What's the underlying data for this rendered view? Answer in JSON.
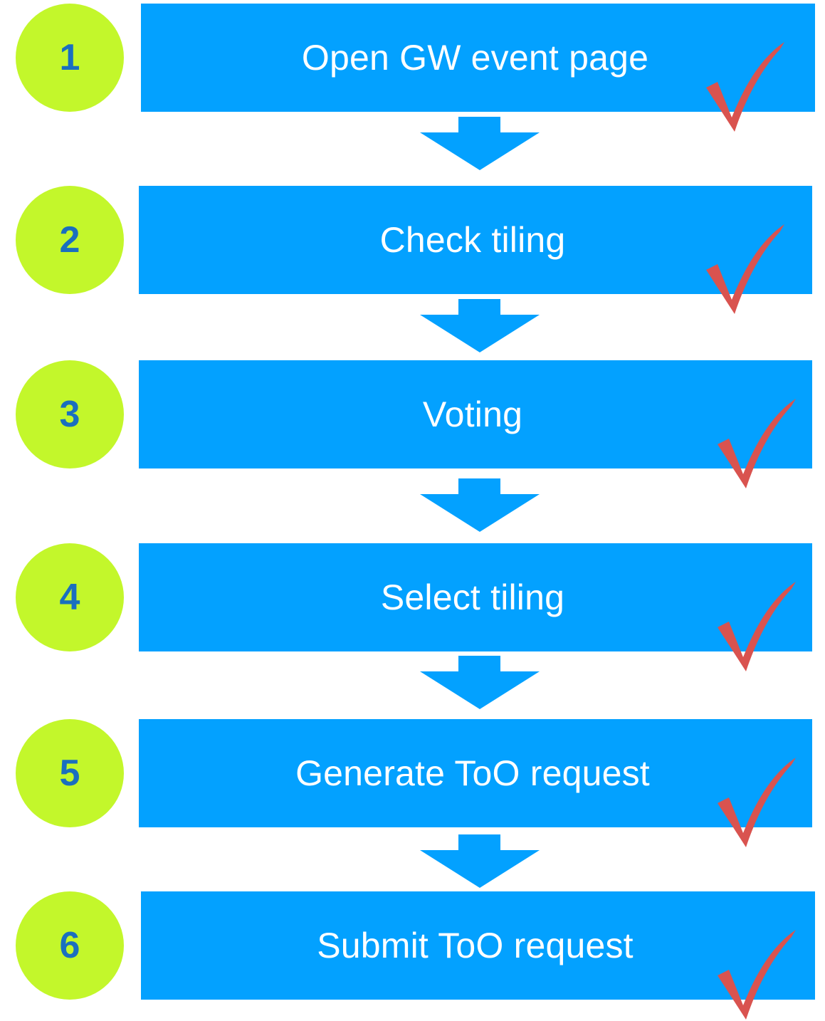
{
  "colors": {
    "step_circle": "#c3f72b",
    "step_number": "#1a6fbf",
    "box": "#03a1ff",
    "box_text": "#ffffff",
    "arrow": "#03a1ff",
    "check": "#d9534f"
  },
  "steps": [
    {
      "number": "1",
      "label": "Open GW event page",
      "status_icon": "checkmark-icon"
    },
    {
      "number": "2",
      "label": "Check tiling",
      "status_icon": "checkmark-icon"
    },
    {
      "number": "3",
      "label": "Voting",
      "status_icon": "checkmark-icon"
    },
    {
      "number": "4",
      "label": "Select tiling",
      "status_icon": "checkmark-icon"
    },
    {
      "number": "5",
      "label": "Generate ToO request",
      "status_icon": "checkmark-icon"
    },
    {
      "number": "6",
      "label": "Submit ToO request",
      "status_icon": "checkmark-icon"
    }
  ]
}
